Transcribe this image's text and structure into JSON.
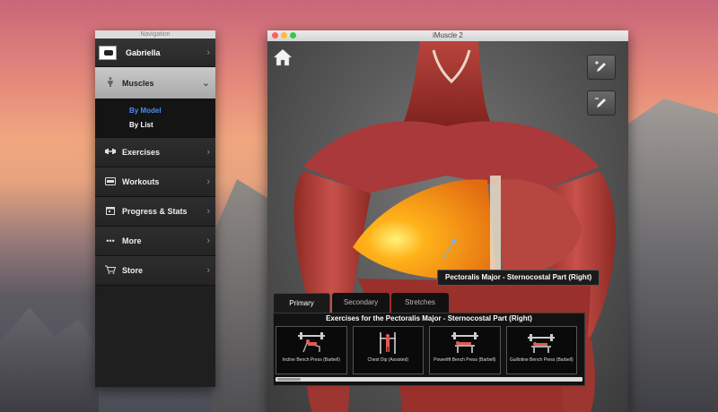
{
  "navigation": {
    "window_title": "Navigation",
    "user": {
      "name": "Gabriella"
    },
    "items": [
      {
        "label": "Muscles",
        "icon": "muscle-figure-icon",
        "active": true
      },
      {
        "label": "Exercises",
        "icon": "dumbbell-icon"
      },
      {
        "label": "Workouts",
        "icon": "workout-card-icon"
      },
      {
        "label": "Progress & Stats",
        "icon": "calendar-icon"
      },
      {
        "label": "More",
        "icon": "ellipsis-icon"
      },
      {
        "label": "Store",
        "icon": "cart-icon"
      }
    ],
    "muscles_subitems": [
      {
        "label": "By Model",
        "selected": true
      },
      {
        "label": "By List",
        "selected": false
      }
    ]
  },
  "app": {
    "title": "iMuscle 2",
    "selected_muscle": "Pectoralis Major - Sternocostal Part (Right)",
    "tabs": [
      {
        "label": "Primary",
        "active": true
      },
      {
        "label": "Secondary",
        "active": false
      },
      {
        "label": "Stretches",
        "active": false
      }
    ],
    "exercises_heading": "Exercises for the Pectoralis Major - Sternocostal Part (Right)",
    "exercises": [
      {
        "label": "Incline Bench Press (Barbell)"
      },
      {
        "label": "Chest Dip (Assisted)"
      },
      {
        "label": "Powerlift Bench Press (Barbell)"
      },
      {
        "label": "Guillotine Bench Press (Barbell)"
      }
    ]
  },
  "colors": {
    "highlight_muscle": "#ff9a1a",
    "selected_subitem": "#4a8cff"
  }
}
